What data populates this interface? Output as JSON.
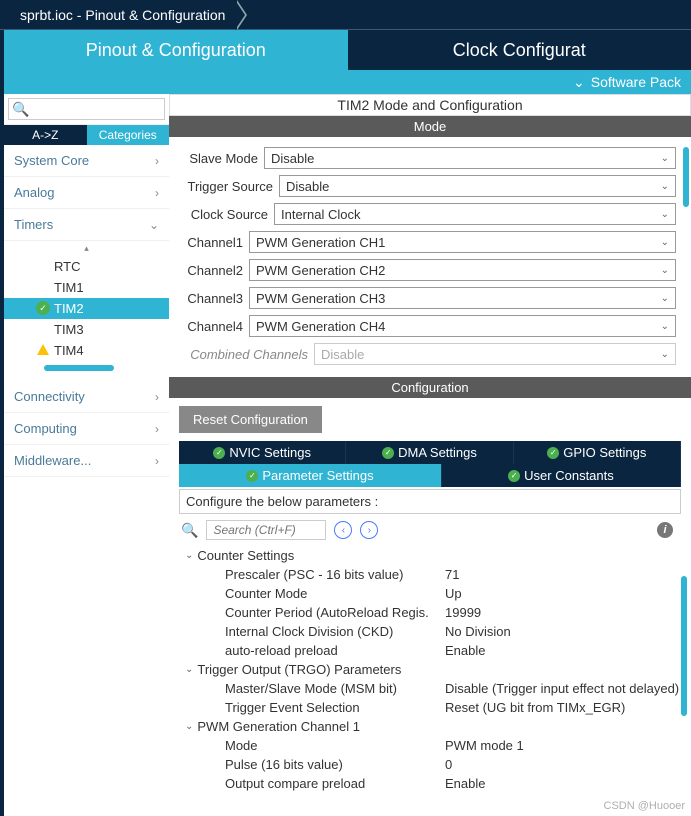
{
  "breadcrumb": {
    "item1": "sprbt.ioc - Pinout & Configuration"
  },
  "topbar": {
    "tab1": "Pinout & Configuration",
    "tab2": "Clock Configurat",
    "subbar": "Software Pack"
  },
  "sidebar": {
    "search_placeholder": "",
    "tab_az": "A->Z",
    "tab_cat": "Categories",
    "cats": {
      "system": "System Core",
      "analog": "Analog",
      "timers": "Timers",
      "connectivity": "Connectivity",
      "computing": "Computing",
      "middleware": "Middleware..."
    },
    "tree": {
      "rtc": "RTC",
      "tim1": "TIM1",
      "tim2": "TIM2",
      "tim3": "TIM3",
      "tim4": "TIM4"
    }
  },
  "content": {
    "title": "TIM2 Mode and Configuration",
    "mode_header": "Mode",
    "config_header": "Configuration",
    "mode": {
      "slave_label": "Slave Mode",
      "slave_value": "Disable",
      "trigger_label": "Trigger Source",
      "trigger_value": "Disable",
      "clock_label": "Clock Source",
      "clock_value": "Internal Clock",
      "ch1_label": "Channel1",
      "ch1_value": "PWM Generation CH1",
      "ch2_label": "Channel2",
      "ch2_value": "PWM Generation CH2",
      "ch3_label": "Channel3",
      "ch3_value": "PWM Generation CH3",
      "ch4_label": "Channel4",
      "ch4_value": "PWM Generation CH4",
      "combined_label": "Combined Channels",
      "combined_value": "Disable"
    },
    "reset_btn": "Reset Configuration",
    "tabs": {
      "nvic": "NVIC Settings",
      "dma": "DMA Settings",
      "gpio": "GPIO Settings",
      "param": "Parameter Settings",
      "user": "User Constants"
    },
    "param_header": "Configure the below parameters :",
    "param_search_placeholder": "Search (Ctrl+F)",
    "groups": {
      "counter": "Counter Settings",
      "trgo": "Trigger Output (TRGO) Parameters",
      "pwm1": "PWM Generation Channel 1"
    },
    "params": {
      "prescaler_l": "Prescaler (PSC - 16 bits value)",
      "prescaler_v": "71",
      "cmode_l": "Counter Mode",
      "cmode_v": "Up",
      "period_l": "Counter Period (AutoReload Regis.",
      "period_v": "19999",
      "ckd_l": "Internal Clock Division (CKD)",
      "ckd_v": "No Division",
      "arp_l": "auto-reload preload",
      "arp_v": "Enable",
      "msm_l": "Master/Slave Mode (MSM bit)",
      "msm_v": "Disable (Trigger input effect not delayed)",
      "tes_l": "Trigger Event Selection",
      "tes_v": "Reset (UG bit from TIMx_EGR)",
      "pmode_l": "Mode",
      "pmode_v": "PWM mode 1",
      "pulse_l": "Pulse (16 bits value)",
      "pulse_v": "0",
      "ocp_l": "Output compare preload",
      "ocp_v": "Enable"
    }
  },
  "watermark": "CSDN @Huooer"
}
